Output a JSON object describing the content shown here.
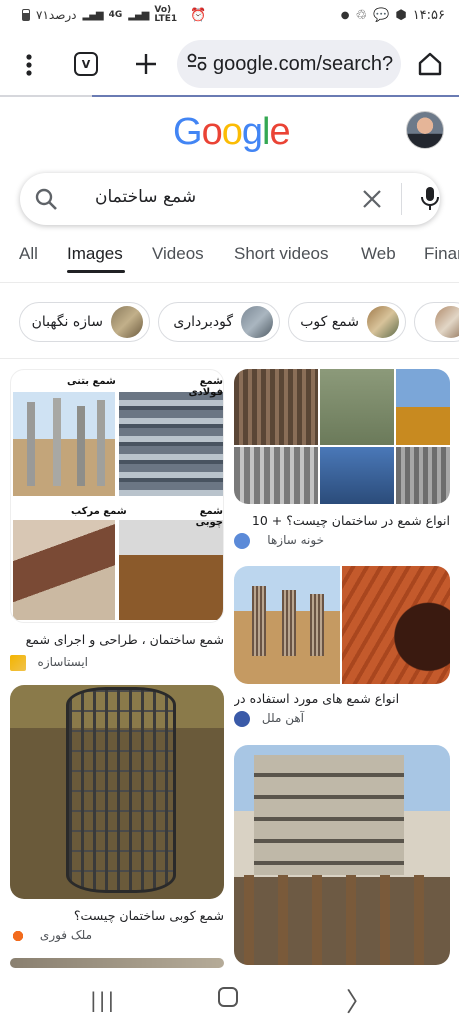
{
  "status_bar": {
    "time": "۱۴:۵۶",
    "battery_text": "۷۱درصد",
    "network_4g": "4G",
    "network_volte": "Vo) LTE1"
  },
  "browser": {
    "url": "google.com/search?",
    "tab_count": "V"
  },
  "google": {
    "logo_letters": [
      "G",
      "o",
      "o",
      "g",
      "l",
      "e"
    ],
    "logo_colors": [
      "#4285F4",
      "#EA4335",
      "#FBBC05",
      "#4285F4",
      "#34A853",
      "#EA4335"
    ]
  },
  "search": {
    "query": "شمع ساختمان"
  },
  "tabs": [
    "All",
    "Images",
    "Videos",
    "Short videos",
    "Web",
    "Finan"
  ],
  "active_tab": "Images",
  "chips": [
    {
      "label": "سازه نگهبان",
      "color": "#8a7a5c"
    },
    {
      "label": "گودبرداری",
      "color": "#7b8895"
    },
    {
      "label": "شمع کوب",
      "color": "#a07a4a"
    },
    {
      "label": "",
      "color": "#b08a6a"
    }
  ],
  "results": [
    {
      "title": "شمع ساختمان ، طراحی و اجرای شمع",
      "source": "ایستاسازه",
      "quad_labels": [
        "شمع فولادی",
        "شمع بتنی",
        "شمع چوبی",
        "شمع مرکب"
      ]
    },
    {
      "title": "انواع شمع در ساختمان چیست؟ + 10",
      "source": "خونه سازها"
    },
    {
      "title": "انواع شمع های مورد استفاده در",
      "source": "آهن ملل"
    },
    {
      "title": "شمع کوبی ساختمان چیست؟",
      "source": "ملک فوری"
    },
    {
      "title": "",
      "source": ""
    }
  ],
  "nav": {
    "recent": "|||",
    "back": "〉"
  }
}
